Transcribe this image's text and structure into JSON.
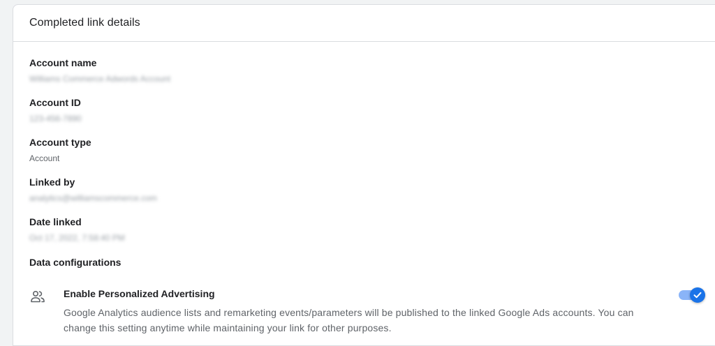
{
  "card": {
    "title": "Completed link details"
  },
  "fields": [
    {
      "label": "Account name",
      "value": "Williams Commerce Adwords Account",
      "blurred": true
    },
    {
      "label": "Account ID",
      "value": "123-456-7890",
      "blurred": true
    },
    {
      "label": "Account type",
      "value": "Account",
      "blurred": false
    },
    {
      "label": "Linked by",
      "value": "analytics@williamscommerce.com",
      "blurred": true
    },
    {
      "label": "Date linked",
      "value": "Oct 17, 2022, 7:58:40 PM",
      "blurred": true
    }
  ],
  "data_configurations": {
    "label": "Data configurations",
    "items": [
      {
        "icon": "people-icon",
        "title": "Enable Personalized Advertising",
        "description": "Google Analytics audience lists and remarketing events/parameters will be published to the linked Google Ads accounts. You can change this setting anytime while maintaining your link for other purposes.",
        "enabled": true
      }
    ]
  },
  "colors": {
    "accent": "#1a73e8",
    "accent_light": "#8ab4f8",
    "text_primary": "#202124",
    "text_secondary": "#5f6368",
    "divider": "#dadce0"
  }
}
